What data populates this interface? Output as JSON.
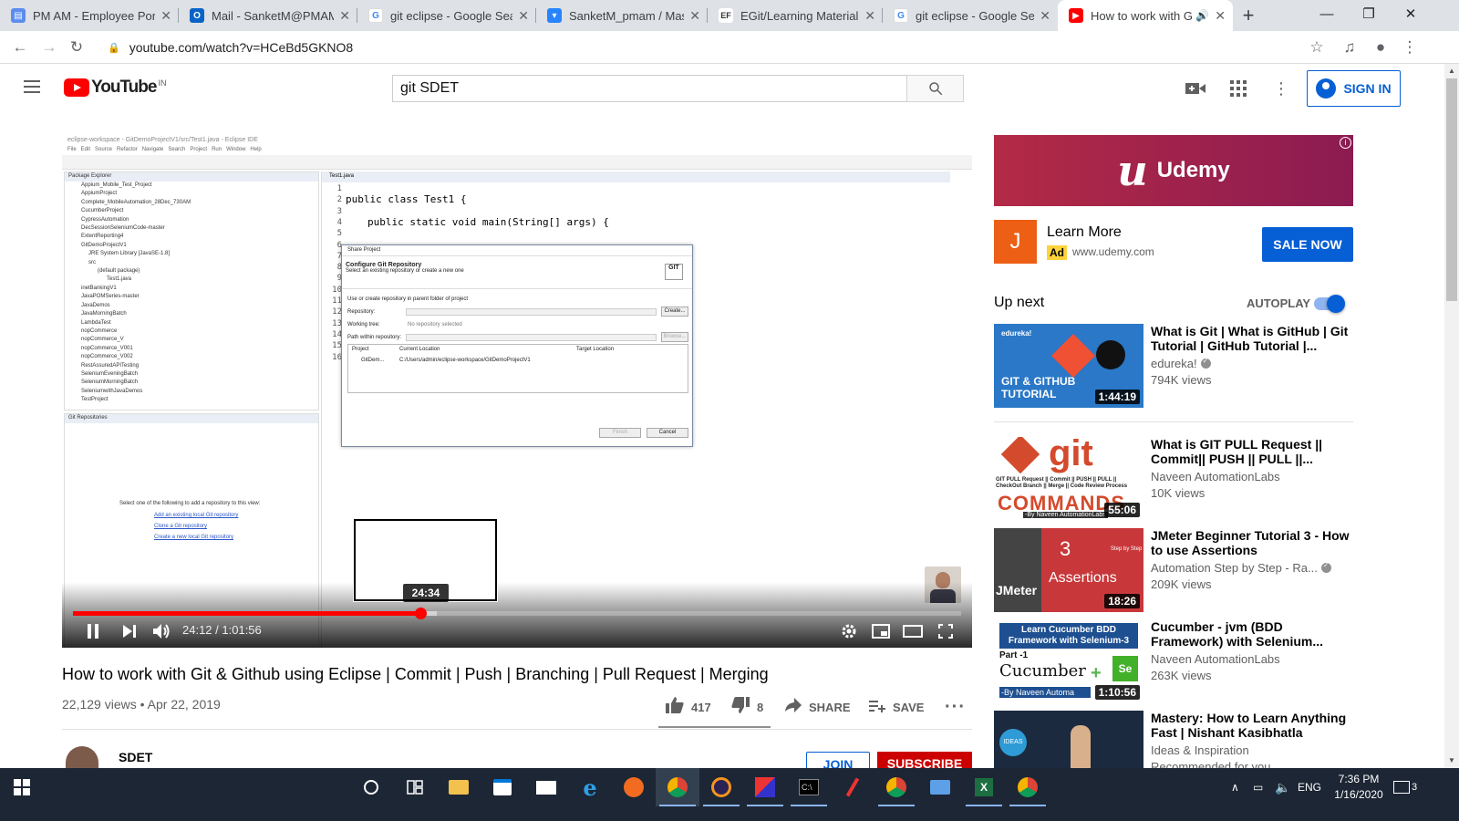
{
  "browser": {
    "tabs": [
      {
        "label": "PM AM - Employee Porta",
        "favicon": "document-icon",
        "color": "#5b8def"
      },
      {
        "label": "Mail - SanketM@PMAM.",
        "favicon": "outlook-icon",
        "color": "#0a64c8"
      },
      {
        "label": "git eclipse - Google Sear",
        "favicon": "google-icon",
        "color": "#ffffff"
      },
      {
        "label": "SanketM_pmam / Maste",
        "favicon": "bitbucket-icon",
        "color": "#2684ff"
      },
      {
        "label": "EGit/Learning Material -",
        "favicon": "eclipse-icon",
        "color": "#ffffff"
      },
      {
        "label": "git eclipse - Google Sear",
        "favicon": "google-icon",
        "color": "#ffffff"
      },
      {
        "label": "How to work with Gi",
        "favicon": "youtube-icon",
        "color": "#ff0000",
        "active": true
      }
    ],
    "url": "youtube.com/watch?v=HCeBd5GKNO8"
  },
  "youtube": {
    "logo_text": "YouTube",
    "country_code": "IN",
    "search_query": "git SDET",
    "sign_in_label": "SIGN IN"
  },
  "player": {
    "current_time": "24:12",
    "duration": "1:01:56",
    "time_separator": " / ",
    "progress_fraction": 0.391,
    "buffered_fraction": 0.41,
    "preview_time": "24:34",
    "ide": {
      "package_items": [
        "Appium_Mobile_Test_Project",
        "AppiumProject",
        "Complete_MobileAutomation_28Dec_730AM",
        "CucumberProject",
        "CypressAutomation",
        "DecSessionSeleniumCode-master",
        "ExtentReporting4",
        "GitDemoProjectV1",
        "JRE System Library [JavaSE-1.8]",
        "src",
        "(default package)",
        "Test1.java",
        "inetBankingV1",
        "JavaPOMSeries-master",
        "JavaDemos",
        "JavaMorningBatch",
        "LambdaTest",
        "nopCommerce",
        "nopCommerce_V",
        "nopCommerce_V001",
        "nopCommerce_V002",
        "RestAssuredAPITesting",
        "SeleniumEveningBatch",
        "SeleniumMorningBatch",
        "SeleniumwithJavaDemos",
        "TestProject"
      ],
      "package_header": "Package Explorer",
      "git_header": "Git Repositories",
      "git_message": "Select one of the following to add a repository to this view:",
      "git_links": [
        "Add an existing local Git repository",
        "Clone a Git repository",
        "Create a new local Git repository"
      ],
      "editor_tab": "Test1.java",
      "code_line_2": "public class Test1 {",
      "code_line_4": "public static void main(String[] args) {",
      "line_numbers": [
        "1",
        "2",
        "3",
        "4",
        "5",
        "6",
        "7",
        "8",
        "9",
        "10",
        "11",
        "12",
        "13",
        "14",
        "15",
        "16"
      ],
      "dialog": {
        "title": "Share Project",
        "heading": "Configure Git Repository",
        "subheading": "Select an existing repository or create a new one",
        "checkbox": "Use or create repository in parent folder of project",
        "repository_label": "Repository:",
        "create_label": "Create...",
        "working_tree_label": "Working tree:",
        "working_tree_value": "No repository selected",
        "path_label": "Path within repository:",
        "browse_label": "Browse...",
        "col_project": "Project",
        "col_current": "Current Location",
        "col_target": "Target Location",
        "row_project": "GitDem...",
        "row_current": "C:/Users/admin/eclipse-workspace/GitDemoProjectV1",
        "finish_label": "Finish",
        "cancel_label": "Cancel",
        "git_badge": "GIT"
      }
    }
  },
  "video": {
    "title": "How to work with Git & Github using Eclipse | Commit | Push | Branching | Pull Request | Merging",
    "views": "22,129 views",
    "date": "Apr 22, 2019",
    "likes": "417",
    "dislikes": "8",
    "share_label": "SHARE",
    "save_label": "SAVE",
    "channel": "SDET",
    "join_label": "JOIN",
    "subscribe_label": "SUBSCRIBE"
  },
  "ad": {
    "brand": "Udemy",
    "logo_letter": "u",
    "advertiser_initial": "J",
    "cta_title": "Learn More",
    "badge": "Ad",
    "url": "www.udemy.com",
    "button": "SALE NOW"
  },
  "sidebar": {
    "up_next_label": "Up next",
    "autoplay_label": "AUTOPLAY",
    "autoplay_on": true,
    "recommendations": [
      {
        "title": "What is Git | What is GitHub | Git Tutorial | GitHub Tutorial |...",
        "channel": "edureka!",
        "verified": true,
        "views": "794K views",
        "duration": "1:44:19",
        "thumb_text": "GIT & GITHUB TUTORIAL",
        "thumb_brand": "edureka!"
      },
      {
        "title": "What is GIT PULL Request || Commit|| PUSH || PULL ||...",
        "channel": "Naveen AutomationLabs",
        "verified": false,
        "views": "10K views",
        "duration": "55:06",
        "thumb_text": "git",
        "thumb_sub": "COMMANDS",
        "thumb_credit": "-By Naveen AutomationLabs",
        "thumb_small": "GIT PULL Request || Commit || PUSH || PULL || CheckOut Branch || Merge || Code Review Process"
      },
      {
        "title": "JMeter Beginner Tutorial 3 - How to use Assertions",
        "channel": "Automation Step by Step - Ra...",
        "verified": true,
        "views": "209K views",
        "duration": "18:26",
        "thumb_num": "3",
        "thumb_text": "Assertions",
        "thumb_brand": "JMeter",
        "thumb_small": "Step by Step"
      },
      {
        "title": "Cucumber - jvm (BDD Framework) with Selenium...",
        "channel": "Naveen AutomationLabs",
        "verified": false,
        "views": "263K views",
        "duration": "1:10:56",
        "thumb_text": "Learn Cucumber BDD Framework with Selenium-3",
        "thumb_part": "Part -1",
        "thumb_brand": "Cucumber",
        "thumb_credit": "-By Naveen Automa"
      },
      {
        "title": "Mastery: How to Learn Anything Fast | Nishant Kasibhatla",
        "channel": "Ideas & Inspiration",
        "verified": false,
        "views": "Recommended for you",
        "duration": "",
        "thumb_text": "IDEAS"
      }
    ]
  },
  "taskbar": {
    "language": "ENG",
    "time": "7:36 PM",
    "date": "1/16/2020",
    "notification_count": "3"
  }
}
